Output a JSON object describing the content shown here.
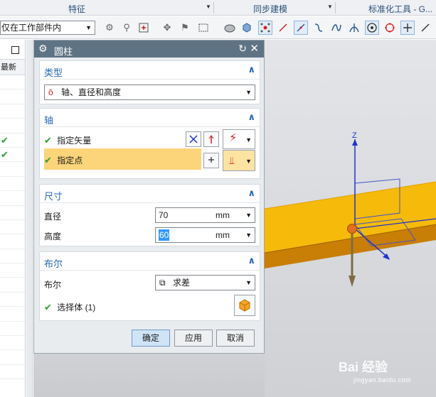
{
  "ribbon": {
    "groups": [
      "特征",
      "同步建模",
      "标准化工具 - G..."
    ]
  },
  "toolbar": {
    "scope_select": "仅在工作部件内"
  },
  "navigator": {
    "column_header": "最新",
    "check_rows": [
      4,
      5
    ]
  },
  "dialog": {
    "title": "圆柱",
    "type_section": {
      "label": "类型",
      "value": "轴、直径和高度"
    },
    "axis_section": {
      "label": "轴",
      "vector_label": "指定矢量",
      "point_label": "指定点"
    },
    "dimension_section": {
      "label": "尺寸",
      "diameter_label": "直径",
      "diameter_value": "70",
      "diameter_unit": "mm",
      "height_label": "高度",
      "height_value": "60",
      "height_unit": "mm"
    },
    "boolean_section": {
      "label": "布尔",
      "boolean_label": "布尔",
      "boolean_value": "求差",
      "select_body_label": "选择体 (1)"
    },
    "buttons": {
      "ok": "确定",
      "apply": "应用",
      "cancel": "取消"
    }
  },
  "viewport": {
    "axis_label": "Z",
    "part_color": "#f6ba0a",
    "part_side_color": "#c97e05"
  },
  "watermark": {
    "brand": "Bai 经验",
    "url": "jingyan.baidu.com"
  }
}
